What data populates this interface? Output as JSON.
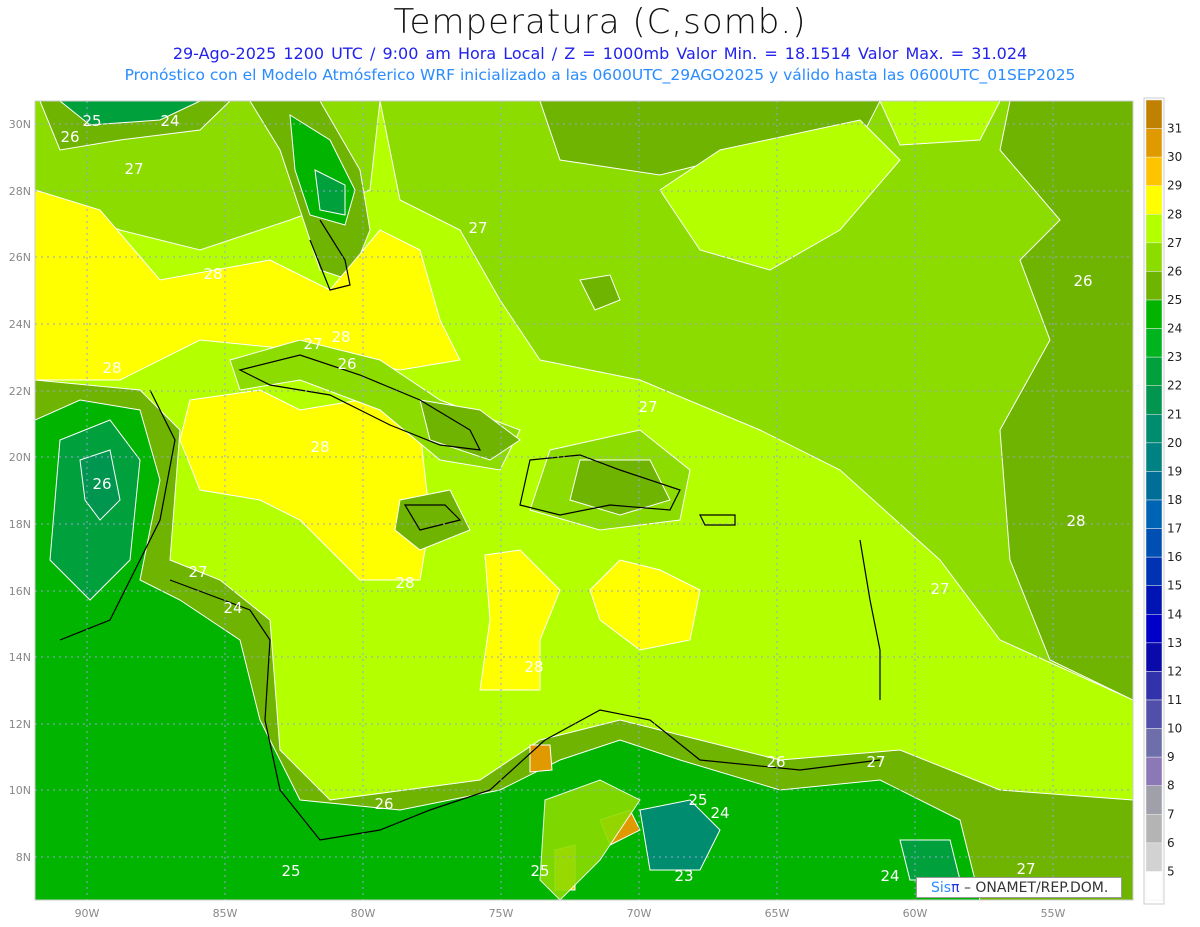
{
  "header": {
    "title": "Temperatura (C,somb.)",
    "subtitle": "29-Ago-2025  1200 UTC / 9:00 am Hora Local / Z = 1000mb    Valor Min. = 18.1514  Valor Max. = 31.024",
    "forecast_note": "Pronóstico con el Modelo Atmósferico WRF inicializado a las 0600UTC_29AGO2025 y válido hasta las  0600UTC_01SEP2025"
  },
  "map": {
    "lat_ticks": [
      "30N",
      "28N",
      "26N",
      "24N",
      "22N",
      "20N",
      "18N",
      "16N",
      "14N",
      "12N",
      "10N",
      "8N"
    ],
    "lon_ticks": [
      "90W",
      "85W",
      "80W",
      "75W",
      "70W",
      "65W",
      "60W",
      "55W"
    ],
    "contour_labels": [
      "25",
      "24",
      "26",
      "27",
      "27",
      "28",
      "28",
      "27",
      "28",
      "26",
      "28",
      "27",
      "28",
      "26",
      "27",
      "24",
      "28",
      "27",
      "28",
      "26",
      "25",
      "24",
      "26",
      "25",
      "23",
      "25",
      "24",
      "27",
      "27",
      "26"
    ]
  },
  "colorbar": {
    "labels": [
      "31",
      "30",
      "29",
      "28",
      "27",
      "26",
      "25",
      "24",
      "23",
      "22",
      "21",
      "20",
      "19",
      "18",
      "17",
      "16",
      "15",
      "14",
      "13",
      "12",
      "11",
      "10",
      "9",
      "8",
      "7",
      "6",
      "5"
    ],
    "colors": [
      "#c08000",
      "#e09a00",
      "#ffc400",
      "#ffff00",
      "#b4ff00",
      "#8cdc00",
      "#6eb400",
      "#00b400",
      "#00b41e",
      "#00a03c",
      "#009650",
      "#008c6e",
      "#008282",
      "#006e96",
      "#0064b4",
      "#0050b4",
      "#0032b4",
      "#0014b4",
      "#0000c8",
      "#0a0aaa",
      "#3232aa",
      "#5050aa",
      "#6e6eaa",
      "#8c78b4",
      "#a0a0aa",
      "#b4b4b4",
      "#d2d2d2",
      "#ffffff"
    ]
  },
  "credit": {
    "sis": "Sis",
    "pi": "π",
    "org": " – ONAMET/REP.DOM."
  }
}
